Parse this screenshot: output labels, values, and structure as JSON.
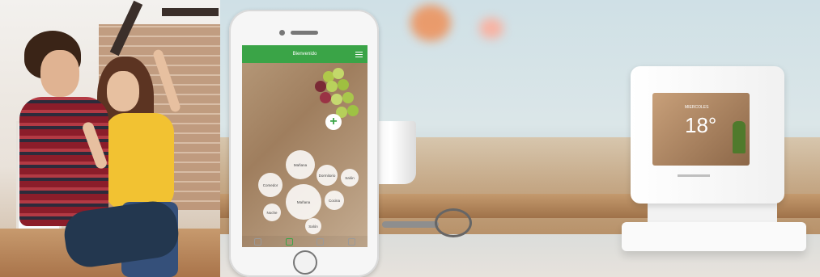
{
  "phone_app": {
    "header_title": "Bienvenido",
    "add_icon": "plus-icon",
    "menu_icon": "hamburger-menu-icon",
    "bubbles": [
      "Mañana",
      "Dormitorio",
      "Salón",
      "Comedor",
      "Mañana",
      "Cocina",
      "Noche",
      "Salón"
    ]
  },
  "thermostat": {
    "temperature": "18°",
    "label": "MIERCOLES"
  }
}
